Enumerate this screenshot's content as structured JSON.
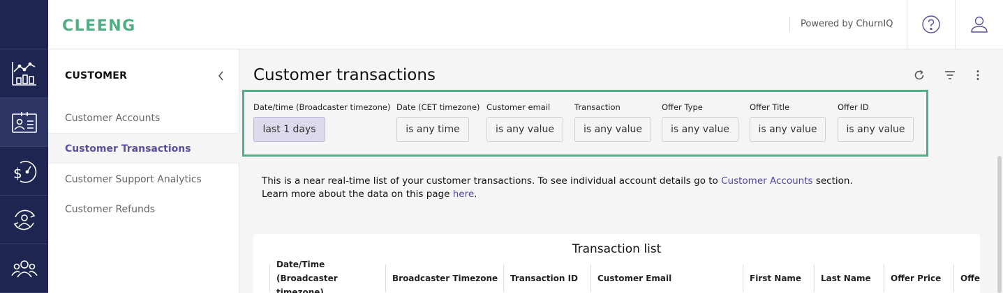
{
  "header": {
    "logo_text": "CLEENG",
    "powered_by": "Powered by ChurnIQ",
    "help_icon": "help-circle-icon",
    "user_icon": "user-icon"
  },
  "rail": {
    "items": [
      {
        "icon": "analytics-chart-icon",
        "active": false
      },
      {
        "icon": "customer-card-icon",
        "active": true
      },
      {
        "icon": "revenue-gauge-icon",
        "active": false
      },
      {
        "icon": "churn-cycle-icon",
        "active": false
      },
      {
        "icon": "users-group-icon",
        "active": false
      }
    ]
  },
  "subnav": {
    "title": "CUSTOMER",
    "items": [
      {
        "label": "Customer Accounts",
        "active": false
      },
      {
        "label": "Customer Transactions",
        "active": true
      },
      {
        "label": "Customer Support Analytics",
        "active": false
      },
      {
        "label": "Customer Refunds",
        "active": false
      }
    ]
  },
  "page": {
    "title": "Customer transactions",
    "toolbar_icons": [
      "refresh-icon",
      "filter-icon",
      "more-vertical-icon"
    ]
  },
  "filters": [
    {
      "label": "Date/time (Broadcaster timezone)",
      "value": "last 1 days"
    },
    {
      "label": "Date (CET timezone)",
      "value": "is any time"
    },
    {
      "label": "Customer email",
      "value": "is any value"
    },
    {
      "label": "Transaction",
      "value": "is any value"
    },
    {
      "label": "Offer Type",
      "value": "is any value"
    },
    {
      "label": "Offer Title",
      "value": "is any value"
    },
    {
      "label": "Offer ID",
      "value": "is any value"
    }
  ],
  "info": {
    "line1_prefix": "This is a near real-time list of your customer transactions. To see individual account details go to ",
    "line1_link": "Customer Accounts",
    "line1_suffix": " section.",
    "line2_prefix": "Learn more about the data on this page ",
    "line2_link": "here",
    "line2_suffix": "."
  },
  "table": {
    "title": "Transaction list",
    "columns": [
      "Date/Time (Broadcaster timezone)",
      "Broadcaster Timezone",
      "Transaction ID",
      "Customer Email",
      "First Name",
      "Last Name",
      "Offer Price",
      "Offer"
    ]
  },
  "colors": {
    "rail_bg": "#1d2550",
    "brand_green": "#4fae84",
    "accent_purple": "#5c4f9b"
  }
}
